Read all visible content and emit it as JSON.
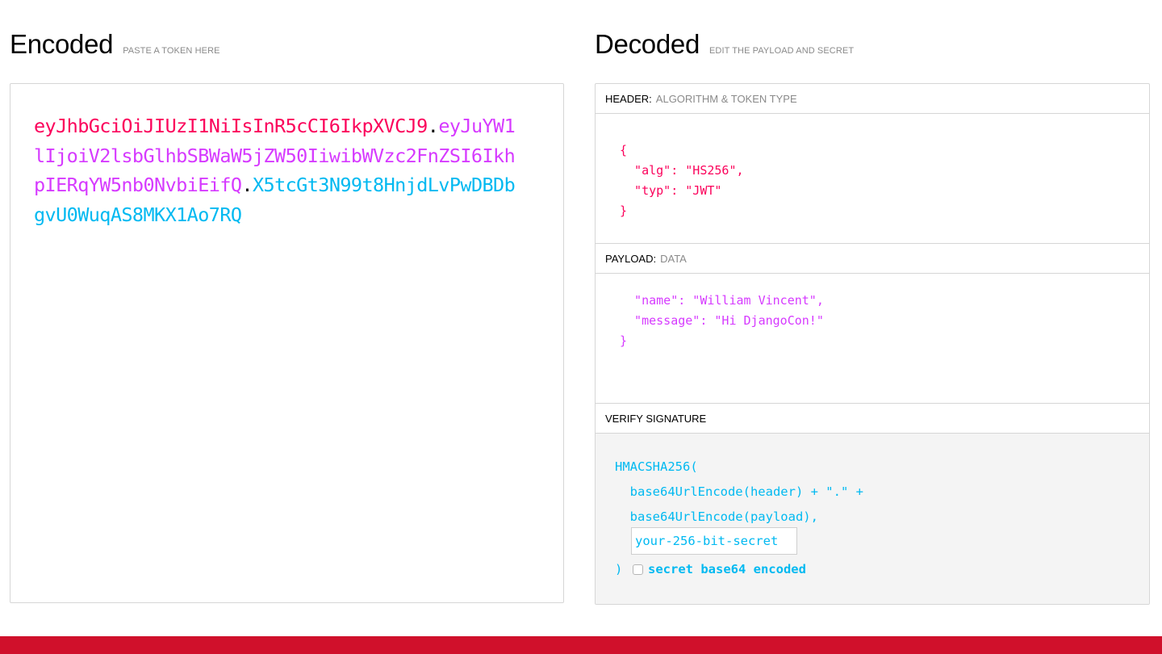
{
  "encoded": {
    "title": "Encoded",
    "subtitle": "PASTE A TOKEN HERE",
    "token": {
      "header": "eyJhbGciOiJIUzI1NiIsInR5cCI6IkpXVCJ9",
      "payload": "eyJuYW1lIjoiV2lsbGlhbSBWaW5jZW50IiwibWVzc2FnZSI6IkhpIERqYW5nb0NvbiEifQ",
      "signature": "X5tcGt3N99t8HnjdLvPwDBDbgvU0WuqAS8MKX1Ao7RQ",
      "dot": "."
    }
  },
  "decoded": {
    "title": "Decoded",
    "subtitle": "EDIT THE PAYLOAD AND SECRET",
    "header_section": {
      "label": "HEADER:",
      "sublabel": "ALGORITHM & TOKEN TYPE",
      "lines": [
        "{",
        "  \"alg\": \"HS256\",",
        "  \"typ\": \"JWT\"",
        "}"
      ]
    },
    "payload_section": {
      "label": "PAYLOAD:",
      "sublabel": "DATA",
      "lines": [
        "  \"name\": \"William Vincent\",",
        "  \"message\": \"Hi DjangoCon!\"",
        "}"
      ]
    },
    "verify_section": {
      "label": "VERIFY SIGNATURE",
      "lines": [
        "HMACSHA256(",
        "  base64UrlEncode(header) + \".\" +",
        "  base64UrlEncode(payload),"
      ],
      "secret_placeholder": "your-256-bit-secret",
      "close_paren": ")",
      "checkbox_label": "secret base64 encoded",
      "checkbox_checked": false
    }
  },
  "colors": {
    "header": "#fb015b",
    "payload": "#d63aff",
    "signature": "#00b9f1",
    "footer": "#d0102b"
  }
}
